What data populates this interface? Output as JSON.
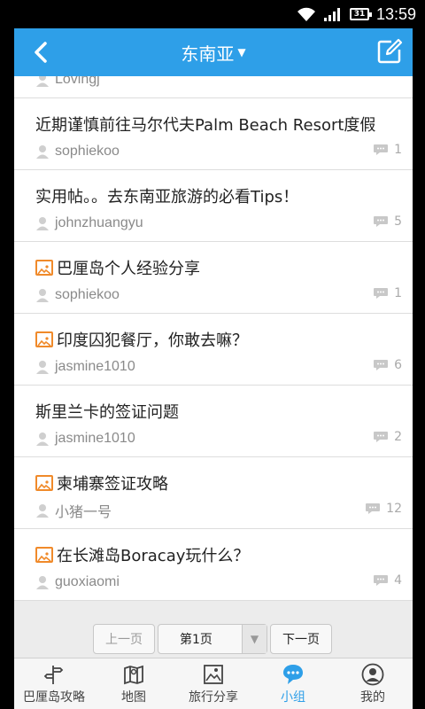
{
  "status": {
    "time": "13:59",
    "battery": "31"
  },
  "header": {
    "title": "东南亚",
    "caret": "▼"
  },
  "partial_item": {
    "author": "Lovingj"
  },
  "posts": [
    {
      "title": "近期谨慎前往马尔代夫Palm Beach Resort度假",
      "has_image": false,
      "author": "sophiekoo",
      "replies": "1"
    },
    {
      "title": "实用帖。。去东南亚旅游的必看Tips！",
      "has_image": false,
      "author": "johnzhuangyu",
      "replies": "5"
    },
    {
      "title": "巴厘岛个人经验分享",
      "has_image": true,
      "author": "sophiekoo",
      "replies": "1"
    },
    {
      "title": "印度囚犯餐厅，你敢去嘛？",
      "has_image": true,
      "author": "jasmine1010",
      "replies": "6"
    },
    {
      "title": "斯里兰卡的签证问题",
      "has_image": false,
      "author": "jasmine1010",
      "replies": "2"
    },
    {
      "title": "柬埔寨签证攻略",
      "has_image": true,
      "author": "小猪一号",
      "replies": "12"
    },
    {
      "title": "在长滩岛Boracay玩什么？",
      "has_image": true,
      "author": "guoxiaomi",
      "replies": "4"
    }
  ],
  "pager": {
    "prev": "上一页",
    "current": "第1页",
    "next": "下一页"
  },
  "tabs": [
    {
      "label": "巴厘岛攻略",
      "icon": "signpost-icon",
      "active": false
    },
    {
      "label": "地图",
      "icon": "map-icon",
      "active": false
    },
    {
      "label": "旅行分享",
      "icon": "photo-icon",
      "active": false
    },
    {
      "label": "小组",
      "icon": "chat-bubble-icon",
      "active": true
    },
    {
      "label": "我的",
      "icon": "profile-icon",
      "active": false
    }
  ],
  "colors": {
    "primary": "#2e9fe8",
    "image_badge": "#f08a2a",
    "muted": "#8a8a8a"
  }
}
